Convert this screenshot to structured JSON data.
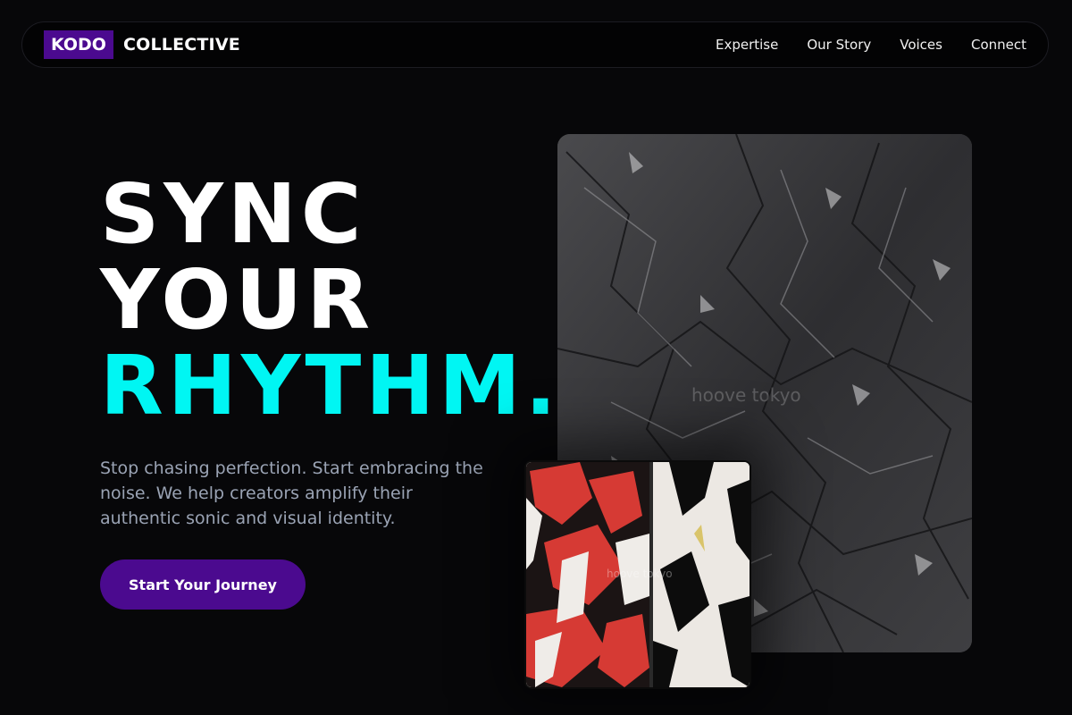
{
  "brand": {
    "badge": "KODO",
    "name": "COLLECTIVE"
  },
  "nav": {
    "links": [
      "Expertise",
      "Our Story",
      "Voices",
      "Connect"
    ]
  },
  "hero": {
    "line1": "SYNC",
    "line2": "YOUR",
    "line3": "RHYTHM.",
    "subtitle": "Stop chasing perfection. Start embracing the noise. We help creators amplify their authentic sonic and visual identity.",
    "cta": "Start Your Journey"
  },
  "images": {
    "large_watermark": "hoove tokyo",
    "small_watermark": "hoove tokyo"
  },
  "colors": {
    "background": "#070709",
    "accent_cyan": "#00f6f3",
    "brand_purple": "#4b0a8f",
    "subtitle_gray": "#9aa3b4"
  }
}
